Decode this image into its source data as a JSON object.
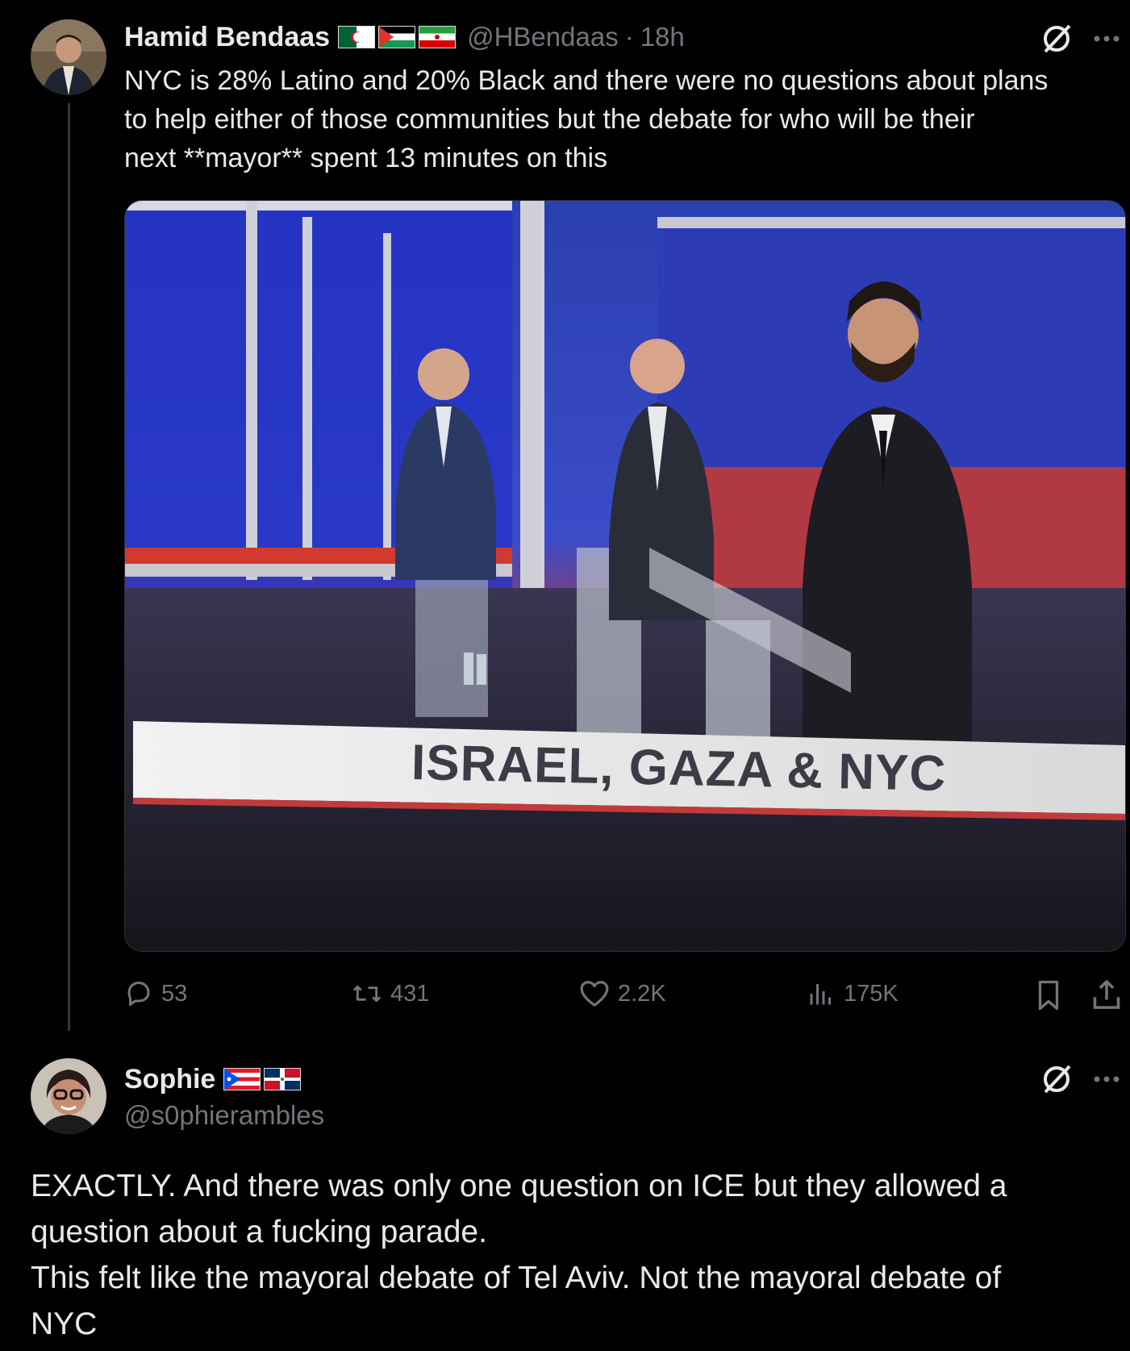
{
  "tweet": {
    "author_name": "Hamid Bendaas",
    "handle": "@HBendaas",
    "separator": "·",
    "time": "18h",
    "text_lines": [
      "NYC is 28% Latino and 20% Black and there were no questions about plans",
      "to help either of those communities but the debate for who will be their",
      "next **mayor** spent 13 minutes on this"
    ],
    "image_banner": "ISRAEL, GAZA & NYC",
    "stats": {
      "replies": "53",
      "reposts": "431",
      "likes": "2.2K",
      "views": "175K"
    }
  },
  "reply": {
    "author_name": "Sophie",
    "handle": "@s0phierambles",
    "text_lines": [
      "EXACTLY. And there was only one question on ICE but they allowed a",
      "question about a fucking parade.",
      "This felt like the mayoral debate of Tel Aviv. Not the mayoral debate of",
      "NYC"
    ]
  },
  "icons": [
    "grok-icon",
    "more-icon",
    "reply-icon",
    "repost-icon",
    "like-icon",
    "views-icon",
    "bookmark-icon",
    "share-icon"
  ],
  "colors": {
    "background": "#000000",
    "text": "#e7e9ea",
    "muted": "#71767b",
    "line": "#333639"
  }
}
